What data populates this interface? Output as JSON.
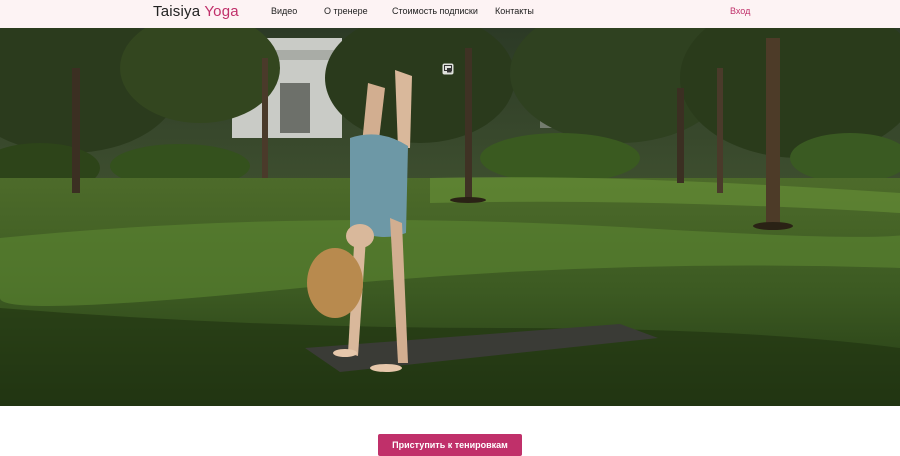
{
  "header": {
    "logo_main": "Taisiya",
    "logo_accent": "Yoga",
    "nav": [
      "Видео",
      "О тренере",
      "Стоимость подписки",
      "Контакты"
    ],
    "login_label": "Вход"
  },
  "hero": {
    "pip_icon": "picture-in-picture-icon"
  },
  "cta": {
    "label": "Приступить к тенировкам"
  },
  "colors": {
    "accent": "#c0306a",
    "header_bg": "#fdf3f4"
  }
}
